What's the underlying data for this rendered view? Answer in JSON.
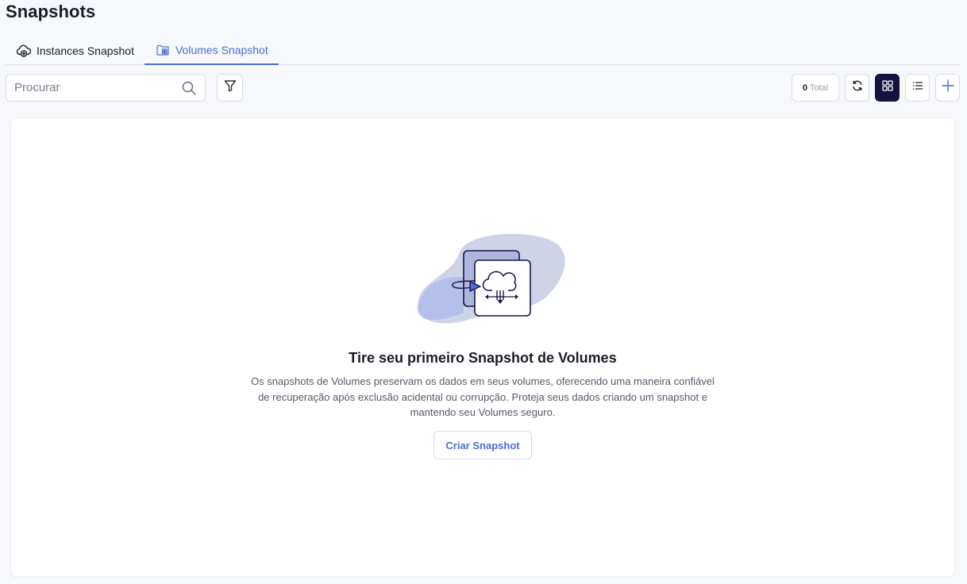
{
  "page": {
    "title": "Snapshots"
  },
  "tabs": [
    {
      "label": "Instances Snapshot",
      "icon": "cloud-plus-icon",
      "active": false
    },
    {
      "label": "Volumes Snapshot",
      "icon": "folder-grid-icon",
      "active": true
    }
  ],
  "toolbar": {
    "search_placeholder": "Procurar",
    "search_value": "",
    "total_count": "0",
    "total_label": "Total",
    "buttons": [
      "filter-icon",
      "refresh-icon",
      "grid-view-icon",
      "list-view-icon",
      "plus-icon"
    ]
  },
  "empty_state": {
    "title": "Tire seu primeiro Snapshot de Volumes",
    "description": "Os snapshots de Volumes preservam os dados em seus volumes, oferecendo uma maneira confiável de recuperação após exclusão acidental ou corrupção. Proteja seus dados criando um snapshot e mantendo seu Volumes seguro.",
    "button_label": "Criar Snapshot"
  },
  "colors": {
    "accent": "#4a6fd8",
    "active_view": "#15123f",
    "background": "#f7f8fc"
  }
}
